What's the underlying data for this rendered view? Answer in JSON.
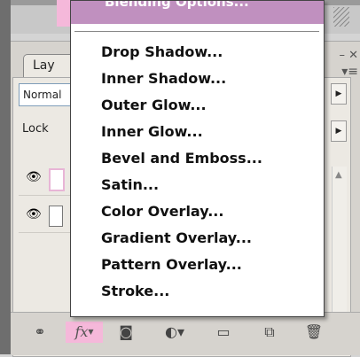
{
  "layers_panel": {
    "tab_label": "Lay",
    "blend_mode_value": "Normal",
    "lock_label": "Lock"
  },
  "fx_menu": {
    "header": "Blending Options...",
    "items": [
      "Drop Shadow...",
      "Inner Shadow...",
      "Outer Glow...",
      "Inner Glow...",
      "Bevel and Emboss...",
      "Satin...",
      "Color Overlay...",
      "Gradient Overlay...",
      "Pattern Overlay...",
      "Stroke..."
    ]
  },
  "toolbar": {
    "fx_label": "fx"
  },
  "colors": {
    "menu_header": "#c090bf",
    "fx_highlight": "#f5b8da"
  }
}
